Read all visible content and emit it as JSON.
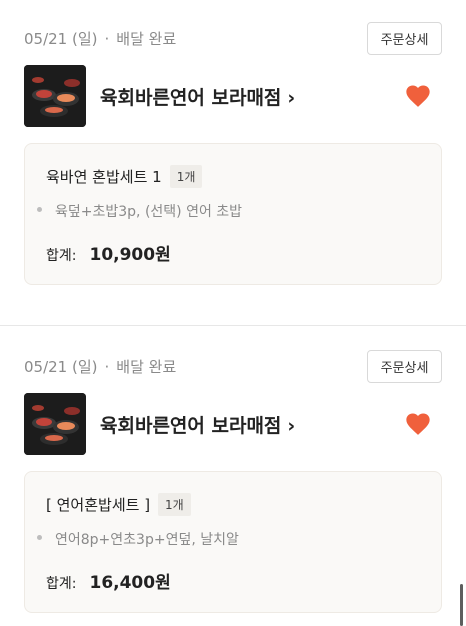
{
  "orders": [
    {
      "date": "05/21 (일)",
      "separator": "·",
      "status": "배달 완료",
      "detail_button": "주문상세",
      "store_name": "육회바른연어 보라매점",
      "store_chevron": "›",
      "favorite_icon": "heart-icon",
      "favorite_color": "#f0603c",
      "item_name": "육바연 혼밥세트 1",
      "quantity": "1개",
      "option": "육덮+초밥3p, (선택) 연어 초밥",
      "total_label": "합계:",
      "total_value": "10,900원"
    },
    {
      "date": "05/21 (일)",
      "separator": "·",
      "status": "배달 완료",
      "detail_button": "주문상세",
      "store_name": "육회바른연어 보라매점",
      "store_chevron": "›",
      "favorite_icon": "heart-icon",
      "favorite_color": "#f0603c",
      "item_name": "[ 연어혼밥세트 ]",
      "quantity": "1개",
      "option": "연어8p+연초3p+연덮, 날치알",
      "total_label": "합계:",
      "total_value": "16,400원"
    }
  ]
}
